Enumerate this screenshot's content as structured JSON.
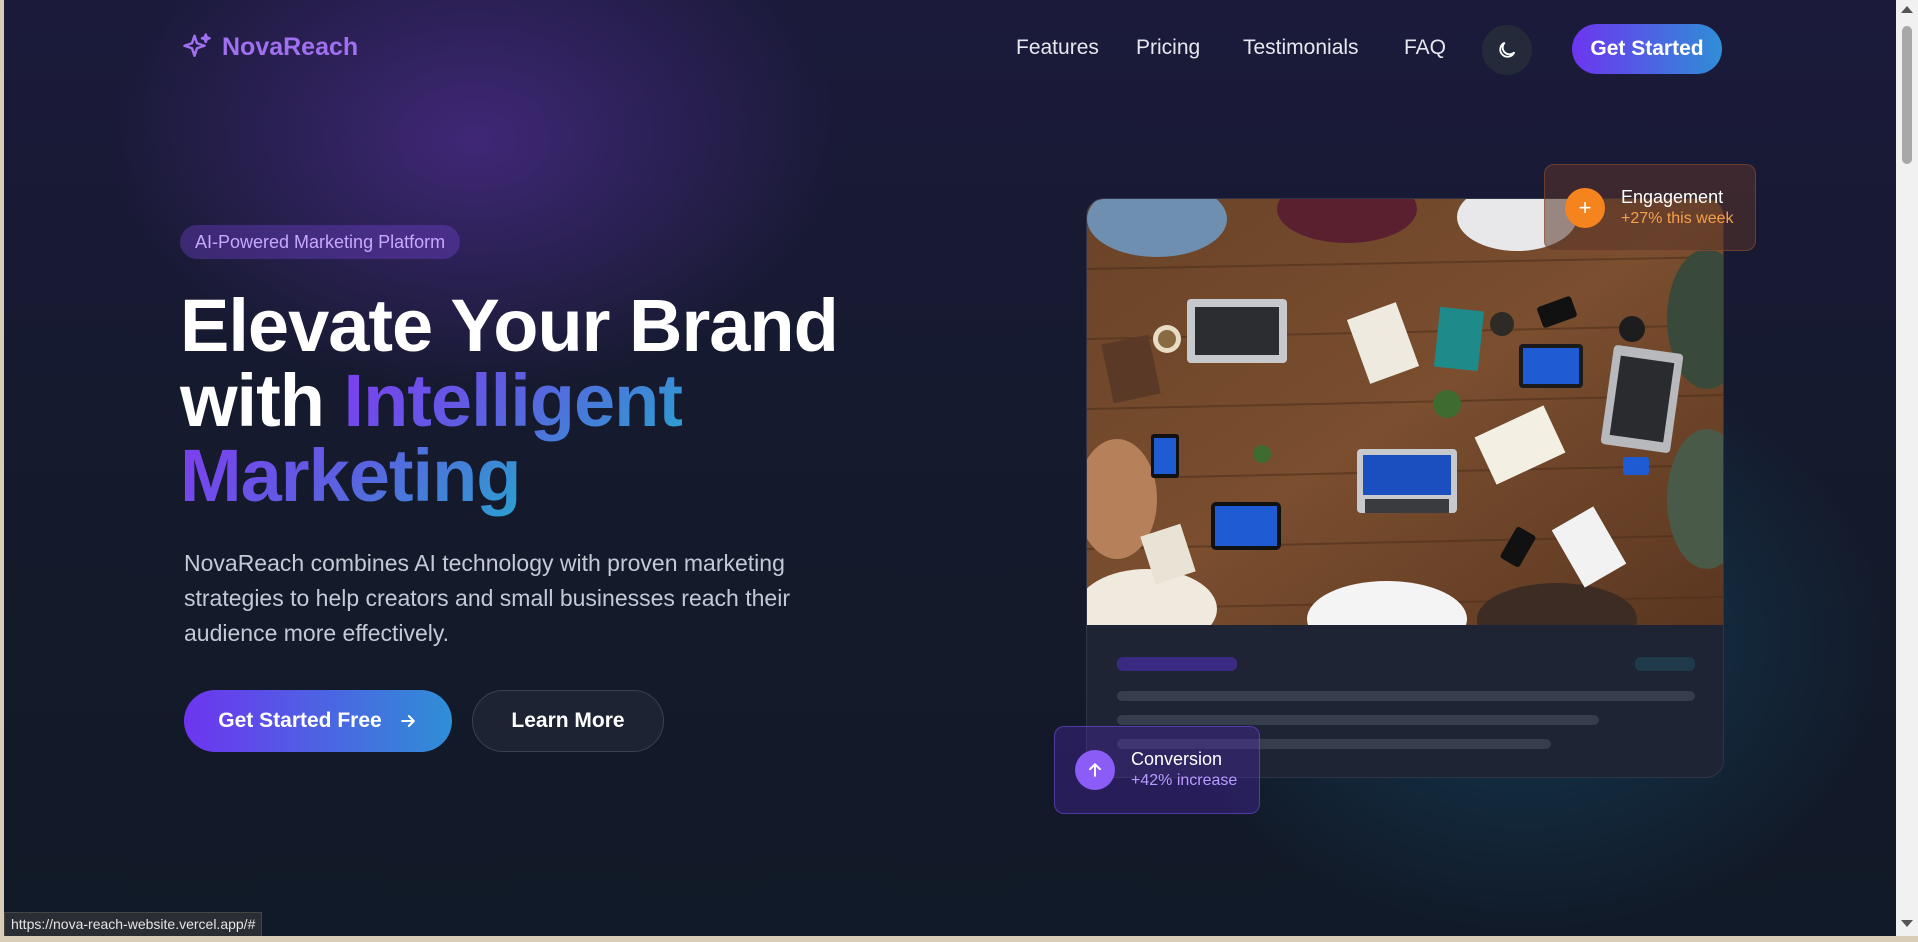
{
  "nav": {
    "brand": "NovaReach",
    "links": [
      "Features",
      "Pricing",
      "Testimonials",
      "FAQ"
    ],
    "theme_toggle_icon": "moon-icon",
    "cta": "Get Started"
  },
  "hero": {
    "badge": "AI-Powered Marketing Platform",
    "headline_line1": "Elevate Your Brand",
    "headline_line2_plain": "with ",
    "headline_line2_accent": "Intelligent",
    "headline_line3_accent": "Marketing",
    "subtitle": "NovaReach combines AI technology with proven marketing strategies to help creators and small businesses reach their audience more effectively.",
    "primary_button": "Get Started Free",
    "primary_button_icon": "arrow-right-icon",
    "secondary_button": "Learn More"
  },
  "stats": {
    "engagement": {
      "title": "Engagement",
      "value": "+27% this week",
      "icon": "plus-icon"
    },
    "conversion": {
      "title": "Conversion",
      "value": "+42% increase",
      "icon": "arrow-up-icon"
    }
  },
  "status_bar": {
    "url": "https://nova-reach-website.vercel.app/#"
  },
  "colors": {
    "brand_purple": "#a070f0",
    "gradient_start": "#6d35f0",
    "gradient_end": "#2f8ed6",
    "engagement_orange": "#f5841f",
    "conversion_purple": "#8b5cf6"
  }
}
